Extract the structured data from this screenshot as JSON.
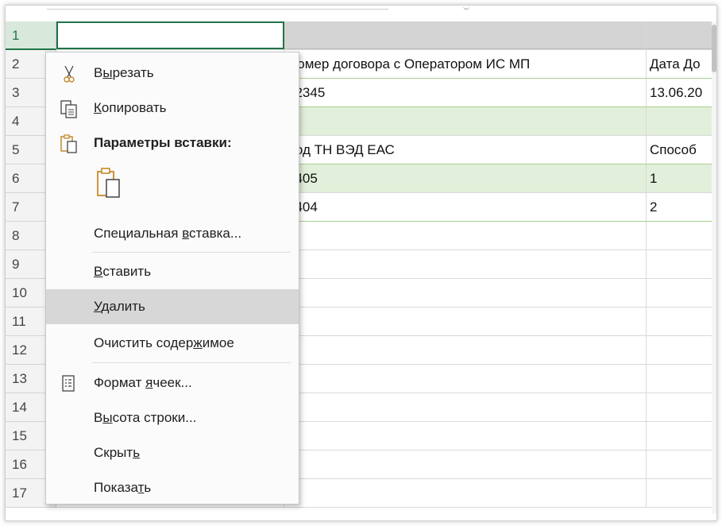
{
  "rows": [
    {
      "num": "1",
      "b": "",
      "c": "",
      "d": ""
    },
    {
      "num": "2",
      "b": "",
      "c": "Номер договора с Оператором ИС МП",
      "d": "Дата До"
    },
    {
      "num": "3",
      "b": "",
      "c": "12345",
      "d": "13.06.20"
    },
    {
      "num": "4",
      "b": "",
      "c": "",
      "d": ""
    },
    {
      "num": "5",
      "b": "",
      "c": "Код ТН ВЭД ЕАС",
      "d": "Способ"
    },
    {
      "num": "6",
      "b": "",
      "c": "6405",
      "d": "1"
    },
    {
      "num": "7",
      "b": "",
      "c": "6404",
      "d": "2"
    },
    {
      "num": "8",
      "b": "",
      "c": "",
      "d": ""
    },
    {
      "num": "9",
      "b": "",
      "c": "",
      "d": ""
    },
    {
      "num": "10",
      "b": "",
      "c": "",
      "d": ""
    },
    {
      "num": "11",
      "b": "",
      "c": "",
      "d": ""
    },
    {
      "num": "12",
      "b": "",
      "c": "",
      "d": ""
    },
    {
      "num": "13",
      "b": "",
      "c": "",
      "d": ""
    },
    {
      "num": "14",
      "b": "",
      "c": "",
      "d": ""
    },
    {
      "num": "15",
      "b": "",
      "c": "",
      "d": ""
    },
    {
      "num": "16",
      "b": "",
      "c": "",
      "d": ""
    },
    {
      "num": "17",
      "b": "",
      "c": "",
      "d": ""
    }
  ],
  "menu": {
    "cut": {
      "pre": "В",
      "u": "ы",
      "post": "резать"
    },
    "copy": {
      "pre": "",
      "u": "К",
      "post": "опировать"
    },
    "paste_options": "Параметры вставки:",
    "paste_special": {
      "pre": "Специальная ",
      "u": "в",
      "post": "ставка..."
    },
    "insert": {
      "pre": "",
      "u": "В",
      "post": "ставить"
    },
    "delete": {
      "pre": "",
      "u": "У",
      "post": "далить"
    },
    "clear": {
      "pre": "Очистить содер",
      "u": "ж",
      "post": "имое"
    },
    "format": {
      "pre": "Формат ",
      "u": "я",
      "post": "чеек..."
    },
    "row_height": {
      "pre": "В",
      "u": "ы",
      "post": "сота строки..."
    },
    "hide": {
      "pre": "Скрыт",
      "u": "ь",
      "post": ""
    },
    "unhide": {
      "pre": "Показа",
      "u": "т",
      "post": "ь"
    }
  },
  "colors": {
    "accent": "#217346",
    "hover": "#d7d7d7",
    "icon": "#c58a2b"
  }
}
